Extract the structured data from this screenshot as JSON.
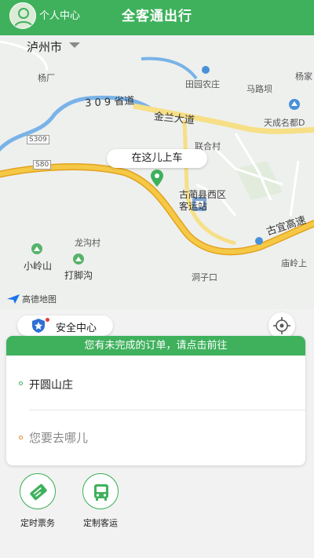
{
  "header": {
    "personal_center": "个人中心",
    "app_title": "全客通出行"
  },
  "map": {
    "city": "泸州市",
    "pickup_hint": "在这儿上车",
    "attribution": "高德地图",
    "labels": {
      "yangchang": "杨厂",
      "tianyuan": "田园农庄",
      "malu": "马路坝",
      "yangjia": "杨家",
      "hwy309": "3 0 9 省道",
      "jinlan": "金兰大道",
      "tiancheng": "天成名都D",
      "s309": "S309",
      "lianhe": "联合村",
      "s80": "S80",
      "gulin_station": "古蔺县西区客运站",
      "gudeng": "古宜高速",
      "longgou": "龙沟村",
      "xiaolingshan": "小岭山",
      "dajiaogou": "打脚沟",
      "dongzikou": "洞子口",
      "miaoling": "庙岭上"
    }
  },
  "safety_center": "安全中心",
  "trip_card": {
    "pending_banner": "您有未完成的订单，请点击前往",
    "origin": "开圆山庄",
    "destination_placeholder": "您要去哪儿"
  },
  "services": [
    {
      "label": "定时票务",
      "icon": "ticket-icon"
    },
    {
      "label": "定制客运",
      "icon": "bus-icon"
    }
  ],
  "colors": {
    "brand_green": "#3fb15d",
    "highway_yellow": "#f2b632",
    "alert_red": "#e23b3b",
    "destination_orange": "#e08a2e"
  }
}
